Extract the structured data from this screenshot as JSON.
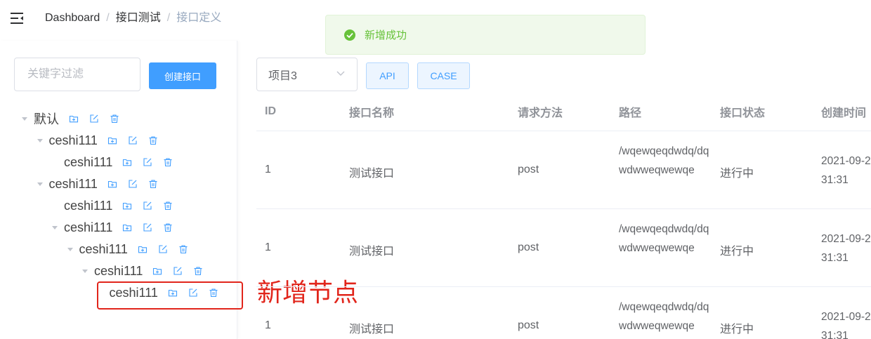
{
  "header": {
    "breadcrumb": [
      "Dashboard",
      "接口测试",
      "接口定义"
    ],
    "separator": "/"
  },
  "toast": {
    "message": "新增成功",
    "type": "success"
  },
  "sidebar": {
    "filter_placeholder": "关键字过滤",
    "create_button": "创建接口",
    "tree": [
      {
        "label": "默认",
        "level": 0,
        "expanded": true
      },
      {
        "label": "ceshi111",
        "level": 1,
        "expanded": true
      },
      {
        "label": "ceshi111",
        "level": 2,
        "expanded": false,
        "leaf": true
      },
      {
        "label": "ceshi111",
        "level": 1,
        "expanded": true
      },
      {
        "label": "ceshi111",
        "level": 2,
        "expanded": false,
        "leaf": true
      },
      {
        "label": "ceshi111",
        "level": 2,
        "expanded": true
      },
      {
        "label": "ceshi111",
        "level": 3,
        "expanded": true
      },
      {
        "label": "ceshi111",
        "level": 4,
        "expanded": true
      },
      {
        "label": "ceshi111",
        "level": 5,
        "expanded": false,
        "leaf": true,
        "highlighted": true
      }
    ],
    "annotation": "新增节点"
  },
  "main": {
    "project_select": "项目3",
    "tabs": [
      "API",
      "CASE"
    ],
    "table": {
      "columns": [
        "ID",
        "接口名称",
        "请求方法",
        "路径",
        "接口状态",
        "创建时间"
      ],
      "rows": [
        {
          "id": "1",
          "name": "测试接口",
          "method": "post",
          "path": "/wqewqeqdwdq/dqwdwweqwewqe",
          "status": "进行中",
          "created": "2021-09-2 31:31"
        },
        {
          "id": "1",
          "name": "测试接口",
          "method": "post",
          "path": "/wqewqeqdwdq/dqwdwweqwewqe",
          "status": "进行中",
          "created": "2021-09-2 31:31"
        },
        {
          "id": "1",
          "name": "测试接口",
          "method": "post",
          "path": "/wqewqeqdwdq/dqwdwweqwewqe",
          "status": "进行中",
          "created": "2021-09-2 31:31"
        }
      ]
    }
  },
  "colors": {
    "primary": "#409eff",
    "success": "#67c23a",
    "annotation": "#e1251b"
  },
  "icons": {
    "menu": "hamburger-fold-icon",
    "add": "folder-add-icon",
    "edit": "edit-icon",
    "delete": "trash-icon",
    "select": "chevron-down-icon",
    "toast": "check-circle-icon"
  }
}
